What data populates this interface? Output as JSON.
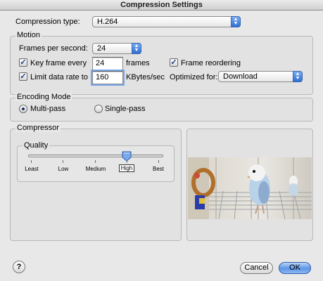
{
  "window": {
    "title": "Compression Settings"
  },
  "compression": {
    "label": "Compression type:",
    "value": "H.264"
  },
  "motion": {
    "title": "Motion",
    "fps_label": "Frames per second:",
    "fps_value": "24",
    "keyframe_label": "Key frame every",
    "keyframe_value": "24",
    "keyframe_units": "frames",
    "keyframe_checked": true,
    "reorder_label": "Frame reordering",
    "reorder_checked": true,
    "limit_label": "Limit data rate to",
    "limit_value": "160",
    "limit_units": "KBytes/sec",
    "limit_checked": true,
    "optimized_label": "Optimized for:",
    "optimized_value": "Download"
  },
  "encoding": {
    "title": "Encoding Mode",
    "multipass_label": "Multi-pass",
    "singlepass_label": "Single-pass",
    "selected": "multi-pass"
  },
  "compressor": {
    "title": "Compressor",
    "quality_title": "Quality",
    "levels": [
      "Least",
      "Low",
      "Medium",
      "High",
      "Best"
    ],
    "selected_level": "High",
    "selected_fraction": 0.75
  },
  "buttons": {
    "help": "?",
    "cancel": "Cancel",
    "ok": "OK"
  },
  "colors": {
    "accent": "#5c95e6",
    "window_bg": "#e8e8e8"
  }
}
